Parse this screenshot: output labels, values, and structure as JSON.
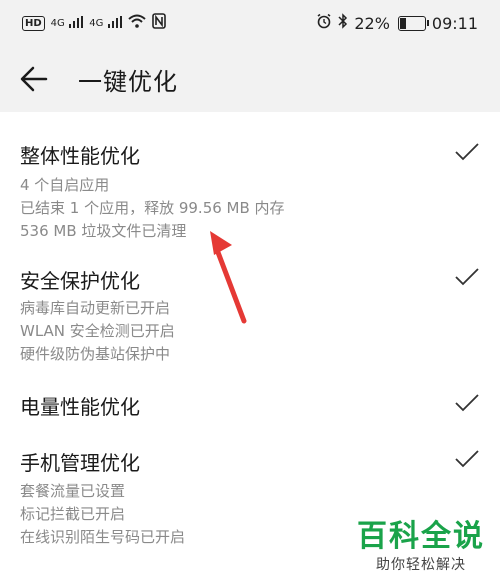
{
  "status_bar": {
    "hd_label": "HD",
    "net1": "4G",
    "net2": "4G",
    "battery_percent": "22%",
    "time": "09:11",
    "icons": [
      "hd-icon",
      "signal-icon",
      "wifi-icon",
      "nfc-icon",
      "alarm-icon",
      "bluetooth-icon",
      "battery-icon"
    ],
    "battery_level": 0.22
  },
  "header": {
    "title": "一键优化"
  },
  "sections": [
    {
      "title": "整体性能优化",
      "lines": [
        "4 个自启应用",
        "已结束 1 个应用，释放 99.56 MB 内存",
        "536 MB 垃圾文件已清理"
      ]
    },
    {
      "title": "安全保护优化",
      "lines": [
        "病毒库自动更新已开启",
        "WLAN 安全检测已开启",
        "硬件级防伪基站保护中"
      ]
    },
    {
      "title": "电量性能优化",
      "lines": []
    },
    {
      "title": "手机管理优化",
      "lines": [
        "套餐流量已设置",
        "标记拦截已开启",
        "在线识别陌生号码已开启"
      ]
    }
  ],
  "watermark": {
    "title": "百科全说",
    "subtitle": "助你轻松解决"
  },
  "colors": {
    "accent_red": "#e53935",
    "watermark_green": "#1aa34a",
    "secondary_text": "#8a8a8a"
  }
}
